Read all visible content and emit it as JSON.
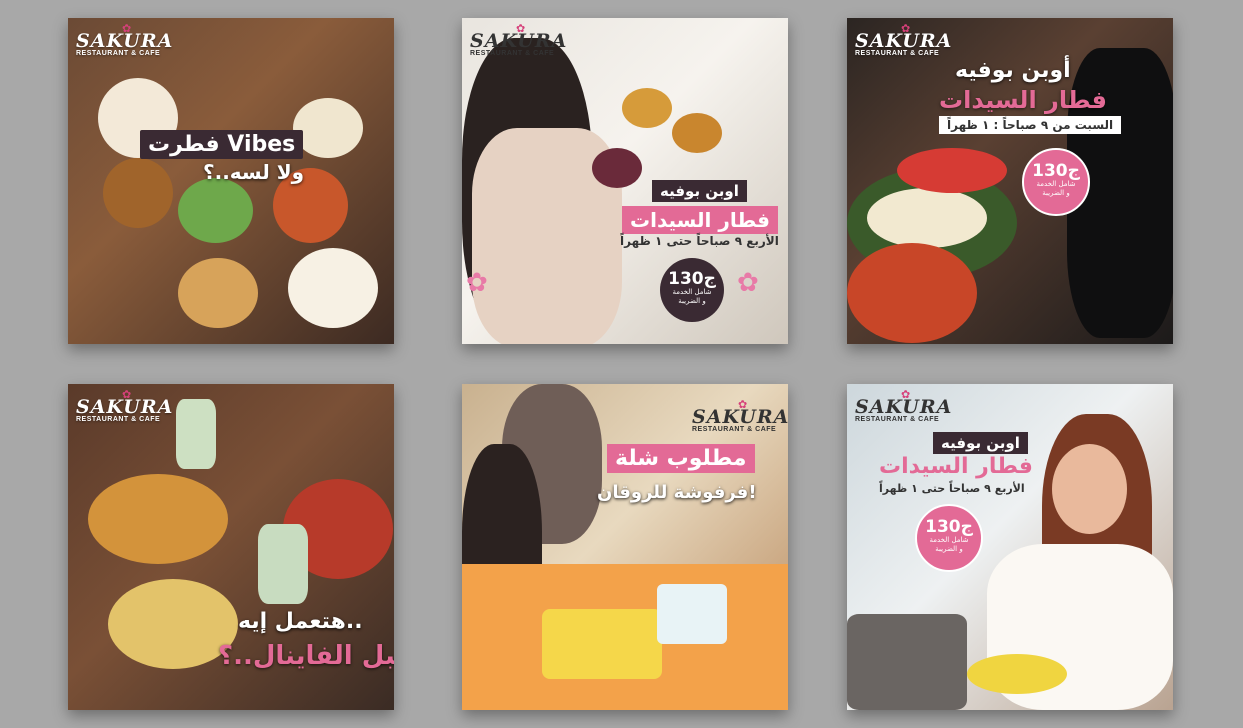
{
  "brand": {
    "name": "SAKURA",
    "tagline": "RESTAURANT & CAFE"
  },
  "posts": [
    {
      "line1": "فطرت Vibes",
      "line2": "ولا لسه..؟"
    },
    {
      "line1": "اوبن بوفيه",
      "line2": "فطار السيدات",
      "line3": "الأربع ٩ صباحاً حتى ١ ظهراً",
      "price": "130ج",
      "price_note_1": "شامل الخدمة",
      "price_note_2": "و الضريبة"
    },
    {
      "line1": "أوبن بوفيه",
      "line2": "فطار السيدات",
      "line3": "السبت من ٩ صباحاً : ١ ظهراً",
      "price": "130ج",
      "price_note_1": "شامل الخدمة",
      "price_note_2": "و الضريبة"
    },
    {
      "line1": "هتعمل إيه..",
      "line2": "قبل الفاينال..؟"
    },
    {
      "line1": "مطلوب شلة",
      "line2": "فرفوشة للروقان!"
    },
    {
      "line1": "اوبن بوفيه",
      "line2": "فطار السيدات",
      "line3": "الأربع ٩ صباحاً حتى ١ ظهراً",
      "price": "130ج",
      "price_note_1": "شامل الخدمة",
      "price_note_2": "و الضريبة"
    }
  ],
  "colors": {
    "background": "#a8a8a8",
    "pink": "#e36a96",
    "dark": "#3a2a33"
  }
}
